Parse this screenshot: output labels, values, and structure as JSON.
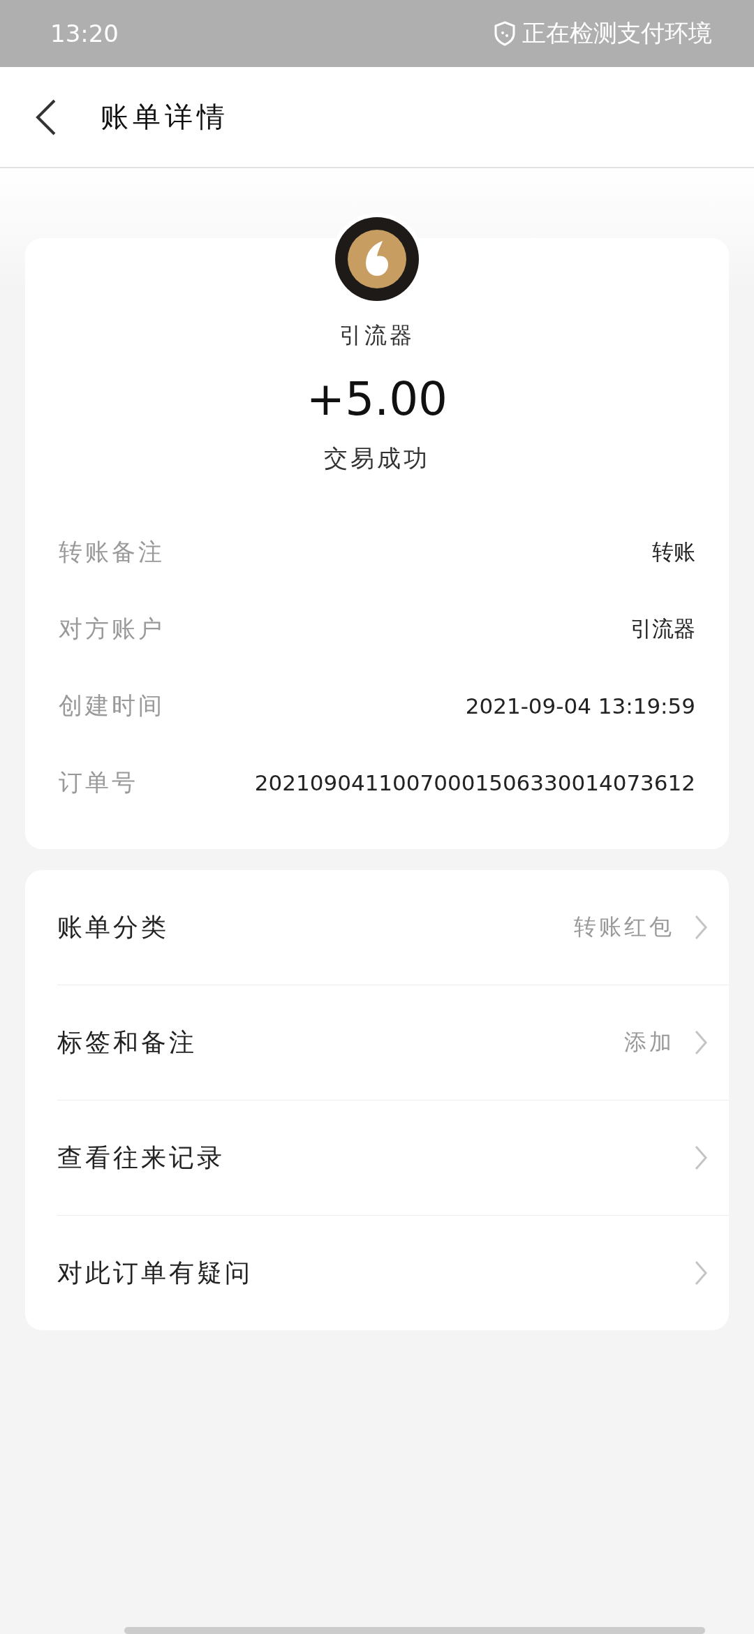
{
  "status_bar": {
    "time": "13:20",
    "notice": "正在检测支付环境"
  },
  "header": {
    "title": "账单详情"
  },
  "summary": {
    "name": "引流器",
    "amount": "+5.00",
    "status": "交易成功"
  },
  "details": [
    {
      "label": "转账备注",
      "value": "转账"
    },
    {
      "label": "对方账户",
      "value": "引流器"
    },
    {
      "label": "创建时间",
      "value": "2021-09-04 13:19:59"
    },
    {
      "label": "订单号",
      "value": "20210904110070001506330014073612"
    }
  ],
  "actions": [
    {
      "label": "账单分类",
      "value": "转账红包"
    },
    {
      "label": "标签和备注",
      "value": "添加"
    },
    {
      "label": "查看往来记录"
    },
    {
      "label": "对此订单有疑问"
    }
  ]
}
